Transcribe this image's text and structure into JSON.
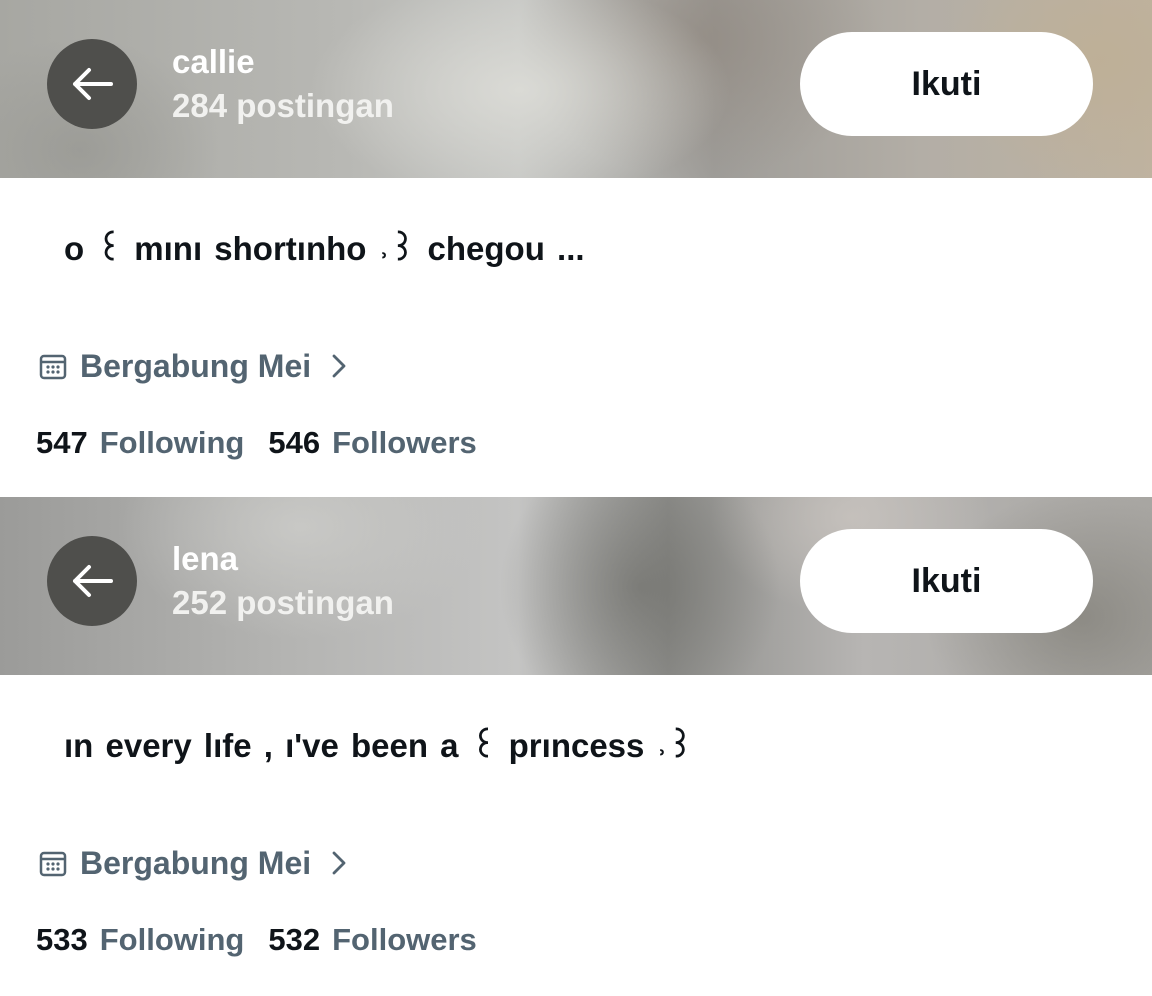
{
  "profiles": [
    {
      "name": "callie",
      "posts": "284 postingan",
      "follow_label": "Ikuti",
      "bio": "o ꒰ mını shortınho ˒꒱ chegou ...",
      "joined": "Bergabung Mei",
      "following_count": "547",
      "following_label": "Following",
      "followers_count": "546",
      "followers_label": "Followers"
    },
    {
      "name": "lena",
      "posts": "252 postingan",
      "follow_label": "Ikuti",
      "bio": "ın every lıfe , ı've been a ꒰ prıncess ˒꒱",
      "joined": "Bergabung Mei",
      "following_count": "533",
      "following_label": "Following",
      "followers_count": "532",
      "followers_label": "Followers"
    }
  ],
  "icons": {
    "back": "arrow-left-icon",
    "calendar": "calendar-icon",
    "chevron": "chevron-right-icon"
  },
  "colors": {
    "text_primary": "#0f1419",
    "text_secondary": "#536471",
    "back_button": "#4f4f4c",
    "follow_button_bg": "#ffffff"
  }
}
